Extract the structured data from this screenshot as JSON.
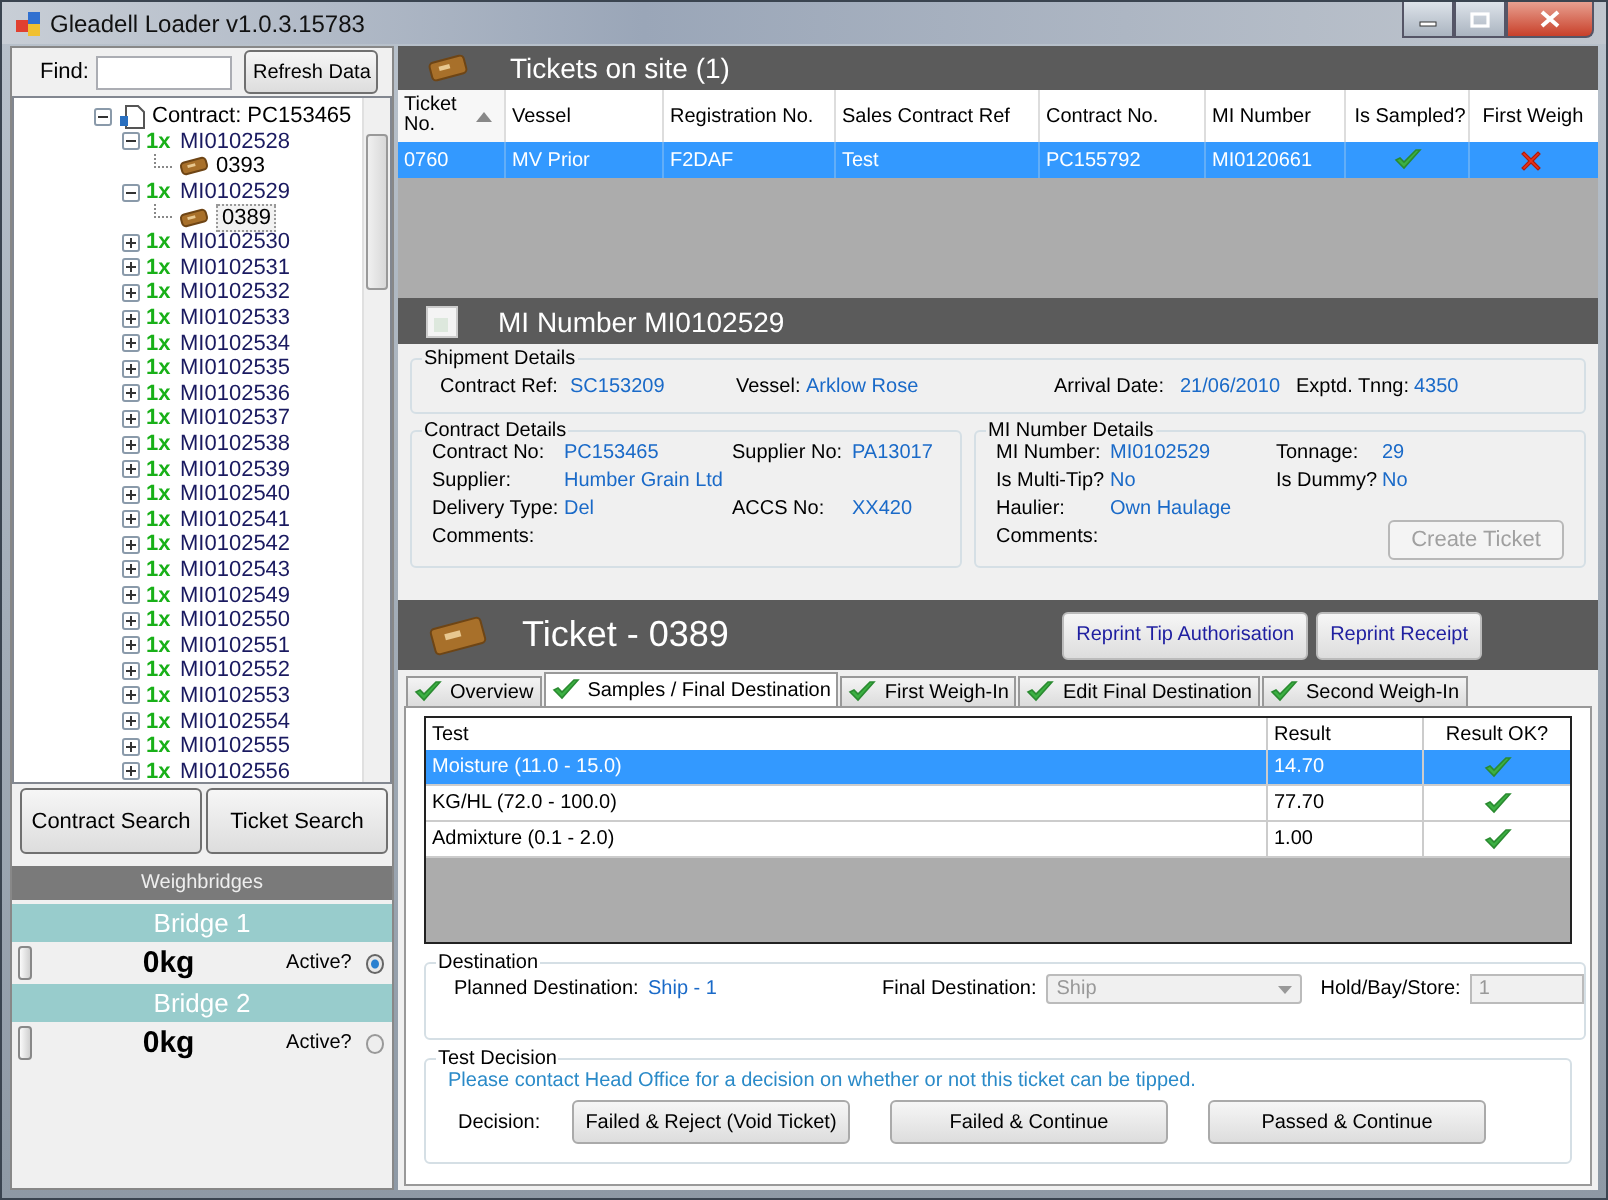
{
  "window": {
    "title": "Gleadell Loader v1.0.3.15783"
  },
  "finder": {
    "label": "Find:",
    "button": "Refresh Data"
  },
  "tree": {
    "kind": "contract",
    "label": "Contract: PC153465",
    "expanded": true,
    "children": [
      {
        "kind": "mi",
        "count": "1x",
        "label": "MI0102528",
        "expanded": true,
        "children": [
          {
            "kind": "ticket",
            "label": "0393",
            "selected": false
          }
        ]
      },
      {
        "kind": "mi",
        "count": "1x",
        "label": "MI0102529",
        "expanded": true,
        "children": [
          {
            "kind": "ticket",
            "label": "0389",
            "selected": true
          }
        ]
      },
      {
        "kind": "mi",
        "count": "1x",
        "label": "MI0102530",
        "expanded": false
      },
      {
        "kind": "mi",
        "count": "1x",
        "label": "MI0102531",
        "expanded": false
      },
      {
        "kind": "mi",
        "count": "1x",
        "label": "MI0102532",
        "expanded": false
      },
      {
        "kind": "mi",
        "count": "1x",
        "label": "MI0102533",
        "expanded": false
      },
      {
        "kind": "mi",
        "count": "1x",
        "label": "MI0102534",
        "expanded": false
      },
      {
        "kind": "mi",
        "count": "1x",
        "label": "MI0102535",
        "expanded": false
      },
      {
        "kind": "mi",
        "count": "1x",
        "label": "MI0102536",
        "expanded": false
      },
      {
        "kind": "mi",
        "count": "1x",
        "label": "MI0102537",
        "expanded": false
      },
      {
        "kind": "mi",
        "count": "1x",
        "label": "MI0102538",
        "expanded": false
      },
      {
        "kind": "mi",
        "count": "1x",
        "label": "MI0102539",
        "expanded": false
      },
      {
        "kind": "mi",
        "count": "1x",
        "label": "MI0102540",
        "expanded": false
      },
      {
        "kind": "mi",
        "count": "1x",
        "label": "MI0102541",
        "expanded": false
      },
      {
        "kind": "mi",
        "count": "1x",
        "label": "MI0102542",
        "expanded": false
      },
      {
        "kind": "mi",
        "count": "1x",
        "label": "MI0102543",
        "expanded": false
      },
      {
        "kind": "mi",
        "count": "1x",
        "label": "MI0102549",
        "expanded": false
      },
      {
        "kind": "mi",
        "count": "1x",
        "label": "MI0102550",
        "expanded": false
      },
      {
        "kind": "mi",
        "count": "1x",
        "label": "MI0102551",
        "expanded": false
      },
      {
        "kind": "mi",
        "count": "1x",
        "label": "MI0102552",
        "expanded": false
      },
      {
        "kind": "mi",
        "count": "1x",
        "label": "MI0102553",
        "expanded": false
      },
      {
        "kind": "mi",
        "count": "1x",
        "label": "MI0102554",
        "expanded": false
      },
      {
        "kind": "mi",
        "count": "1x",
        "label": "MI0102555",
        "expanded": false
      },
      {
        "kind": "mi",
        "count": "1x",
        "label": "MI0102556",
        "expanded": false
      }
    ]
  },
  "search_buttons": [
    "Contract Search",
    "Ticket Search"
  ],
  "weighbridges": {
    "title": "Weighbridges",
    "bridges": [
      {
        "name": "Bridge 1",
        "reading": "0kg",
        "active_label": "Active?",
        "selected": true
      },
      {
        "name": "Bridge 2",
        "reading": "0kg",
        "active_label": "Active?",
        "selected": false
      }
    ]
  },
  "tickets": {
    "title": "Tickets on site (1)",
    "columns": [
      {
        "label": "Ticket No.",
        "sorted": true
      },
      {
        "label": "Vessel",
        "sorted": false
      },
      {
        "label": "Registration No.",
        "sorted": false
      },
      {
        "label": "Sales Contract Ref",
        "sorted": false
      },
      {
        "label": "Contract No.",
        "sorted": false
      },
      {
        "label": "MI Number",
        "sorted": false
      },
      {
        "label": "Is Sampled?",
        "sorted": false
      },
      {
        "label": "First Weigh",
        "sorted": false
      }
    ],
    "rows": [
      {
        "cells": [
          "0760",
          "MV Prior",
          "F2DAF",
          "Test",
          "PC155792",
          "MI0120661"
        ],
        "is_sampled": true,
        "first_weigh": false,
        "selected": true
      }
    ]
  },
  "mi_number": {
    "title": "MI Number MI0102529",
    "shipment": {
      "title": "Shipment Details",
      "fields": [
        {
          "label": "Contract Ref:",
          "value": "SC153209"
        },
        {
          "label": "Vessel:",
          "value": "Arklow Rose"
        },
        {
          "label": "Arrival Date:",
          "value": "21/06/2010"
        },
        {
          "label": "Exptd. Tnng:",
          "value": "4350"
        }
      ]
    },
    "contract": {
      "title": "Contract Details",
      "rows": [
        [
          {
            "label": "Contract No:",
            "value": "PC153465"
          },
          {
            "label": "Supplier No:",
            "value": "PA13017"
          }
        ],
        [
          {
            "label": "Supplier:",
            "value": "Humber Grain Ltd"
          }
        ],
        [
          {
            "label": "Delivery Type:",
            "value": "Del"
          },
          {
            "label": "ACCS No:",
            "value": "XX420"
          }
        ],
        [
          {
            "label": "Comments:"
          }
        ]
      ]
    },
    "details": {
      "title": "MI Number Details",
      "rows": [
        [
          {
            "label": "MI Number:",
            "value": "MI0102529"
          },
          {
            "label": "Tonnage:",
            "value": "29"
          }
        ],
        [
          {
            "label": "Is Multi-Tip?",
            "value": "No"
          },
          {
            "label": "Is Dummy?",
            "value": "No"
          }
        ],
        [
          {
            "label": "Haulier:",
            "value": "Own Haulage"
          }
        ],
        [
          {
            "label": "Comments:"
          }
        ]
      ],
      "button": {
        "label": "Create Ticket",
        "disabled": true
      }
    }
  },
  "ticket": {
    "title": "Ticket - 0389",
    "buttons": [
      "Reprint Tip Authorisation",
      "Reprint Receipt"
    ],
    "tabs": [
      {
        "label": "Overview",
        "checked": true,
        "selected": false
      },
      {
        "label": "Samples / Final Destination",
        "checked": true,
        "selected": true
      },
      {
        "label": "First Weigh-In",
        "checked": true,
        "selected": false
      },
      {
        "label": "Edit Final Destination",
        "checked": true,
        "selected": false
      },
      {
        "label": "Second Weigh-In",
        "checked": true,
        "selected": false
      }
    ],
    "samples": {
      "columns": [
        "Test",
        "Result",
        "Result OK?"
      ],
      "rows": [
        {
          "test": "Moisture (11.0 - 15.0)",
          "result": "14.70",
          "ok": true,
          "selected": true
        },
        {
          "test": "KG/HL (72.0 - 100.0)",
          "result": "77.70",
          "ok": true,
          "selected": false
        },
        {
          "test": "Admixture (0.1 - 2.0)",
          "result": "1.00",
          "ok": true,
          "selected": false
        }
      ]
    },
    "destination": {
      "title": "Destination",
      "planned_label": "Planned Destination:",
      "planned_value": "Ship - 1",
      "final_label": "Final Destination:",
      "final_value": "Ship",
      "hold_label": "Hold/Bay/Store:",
      "hold_value": "1",
      "disabled": true
    },
    "decision": {
      "title": "Test Decision",
      "message": "Please contact Head Office for a decision on whether or not this ticket can be tipped.",
      "label": "Decision:",
      "buttons": [
        "Failed & Reject (Void Ticket)",
        "Failed & Continue",
        "Passed & Continue"
      ]
    }
  }
}
